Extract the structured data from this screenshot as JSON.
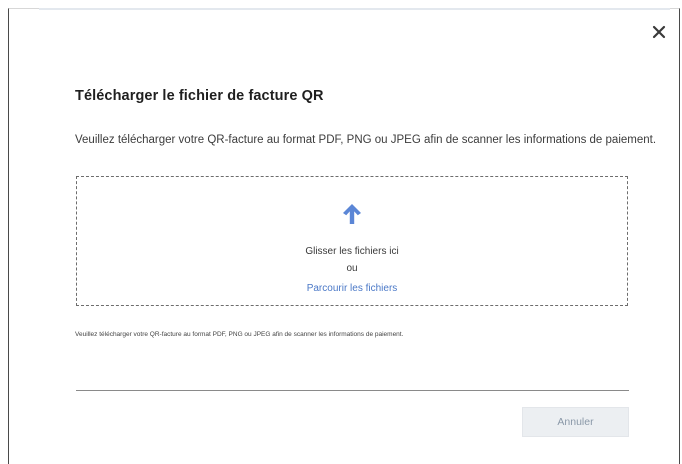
{
  "dialog": {
    "title": "Télécharger le fichier de facture QR",
    "description": "Veuillez télécharger votre QR-facture au format PDF, PNG ou JPEG afin de scanner les informations de paiement.",
    "close_icon": "close-icon",
    "dropzone": {
      "icon": "upload-arrow-icon",
      "drop_text": "Glisser les fichiers ici",
      "or_text": "ou",
      "browse_link": "Parcourir les fichiers"
    },
    "hint": "Veuillez télécharger votre QR-facture au format PDF, PNG ou JPEG afin de scanner les informations de paiement.",
    "buttons": {
      "cancel_label": "Annuler"
    }
  },
  "colors": {
    "accent": "#4a78c7",
    "upload_icon": "#5b86d6",
    "cancel_bg": "#eceff2",
    "cancel_text": "#8a98a8"
  }
}
